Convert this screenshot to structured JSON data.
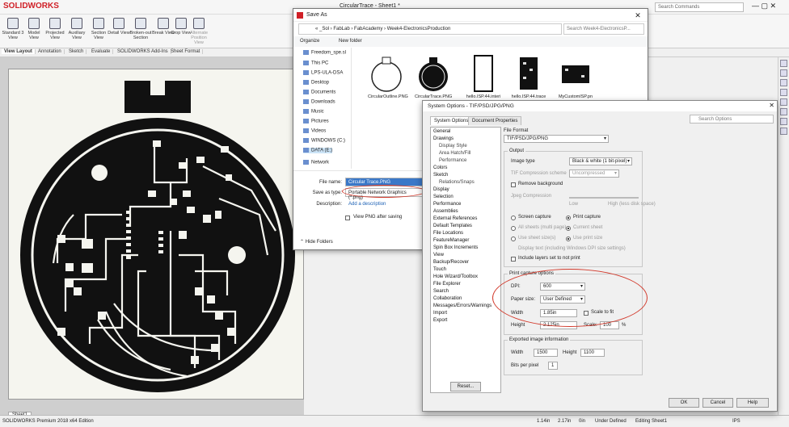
{
  "app": {
    "logo": "SOLIDWORKS",
    "title": "CircularTrace - Sheet1 *",
    "search_placeholder": "Search Commands"
  },
  "ribbon": [
    {
      "label": "Standard 3 View"
    },
    {
      "label": "Model View"
    },
    {
      "label": "Projected View"
    },
    {
      "label": "Auxiliary View"
    },
    {
      "label": "Section View"
    },
    {
      "label": "Detail View"
    },
    {
      "label": "Broken-out Section"
    },
    {
      "label": "Break View"
    },
    {
      "label": "Crop View"
    },
    {
      "label": "Alternate Position View"
    }
  ],
  "sheet_tabs": [
    "View Layout",
    "Annotation",
    "Sketch",
    "Evaluate",
    "SOLIDWORKS Add-Ins",
    "Sheet Format"
  ],
  "sheet_name": "Sheet1",
  "status": {
    "left": "SOLIDWORKS Premium 2018 x64 Edition",
    "x": "1.14in",
    "y": "2.17in",
    "z": "0in",
    "scale": "Under Defined",
    "mode": "Editing Sheet1",
    "units": "IPS"
  },
  "save_as": {
    "title": "Save As",
    "address": "« _Sol › FabLab › FabAcademy › Week4-ElectronicsProduction",
    "search": "Search Week4-ElectronicsP...",
    "organize": "Organize",
    "new_folder": "New folder",
    "nav": [
      "Freedom_spe.sl",
      "This PC",
      "LPS-ULA-DSA",
      "Desktop",
      "Documents",
      "Downloads",
      "Music",
      "Pictures",
      "Videos",
      "WINDOWS (C:)",
      "DATA (E:)",
      "Network"
    ],
    "files": [
      "CircularOutline.PNG",
      "CircularTrace.PNG",
      "hello.ISP.44.interi",
      "hello.ISP.44.trace",
      "MyCustomISP.pn"
    ],
    "file_name_label": "File name:",
    "file_name": "Circular Trace.PNG",
    "save_type_label": "Save as type:",
    "save_type": "Portable Network Graphics (*.png)",
    "description_label": "Description:",
    "description": "Add a description",
    "view_after": "View PNG after saving",
    "hide_folders": "Hide Folders"
  },
  "sysopt": {
    "title": "System Options - TIF/PSD/JPG/PNG",
    "tab_system": "System Options",
    "tab_document": "Document Properties",
    "search": "Search Options",
    "tree": [
      {
        "label": "General",
        "sub": false
      },
      {
        "label": "Drawings",
        "sub": false
      },
      {
        "label": "Display Style",
        "sub": true
      },
      {
        "label": "Area Hatch/Fill",
        "sub": true
      },
      {
        "label": "Performance",
        "sub": true
      },
      {
        "label": "Colors",
        "sub": false
      },
      {
        "label": "Sketch",
        "sub": false
      },
      {
        "label": "Relations/Snaps",
        "sub": true
      },
      {
        "label": "Display",
        "sub": false
      },
      {
        "label": "Selection",
        "sub": false
      },
      {
        "label": "Performance",
        "sub": false
      },
      {
        "label": "Assemblies",
        "sub": false
      },
      {
        "label": "External References",
        "sub": false
      },
      {
        "label": "Default Templates",
        "sub": false
      },
      {
        "label": "File Locations",
        "sub": false
      },
      {
        "label": "FeatureManager",
        "sub": false
      },
      {
        "label": "Spin Box Increments",
        "sub": false
      },
      {
        "label": "View",
        "sub": false
      },
      {
        "label": "Backup/Recover",
        "sub": false
      },
      {
        "label": "Touch",
        "sub": false
      },
      {
        "label": "Hole Wizard/Toolbox",
        "sub": false
      },
      {
        "label": "File Explorer",
        "sub": false
      },
      {
        "label": "Search",
        "sub": false
      },
      {
        "label": "Collaboration",
        "sub": false
      },
      {
        "label": "Messages/Errors/Warnings",
        "sub": false
      },
      {
        "label": "Import",
        "sub": false
      },
      {
        "label": "Export",
        "sub": false
      }
    ],
    "file_format_label": "File Format",
    "file_format": "TIF/PSD/JPG/PNG",
    "output_label": "Output",
    "image_type_label": "Image type",
    "image_type": "Black & white (1 bit-pixel)",
    "tif_comp_label": "TIF Compression scheme",
    "tif_comp": "Uncompressed",
    "remove_bg": "Remove background",
    "jpeg_comp": "Jpeg Compression",
    "jpeg_low": "Low",
    "jpeg_high": "High (less disk space)",
    "screen_capture": "Screen capture",
    "print_capture": "Print capture",
    "all_sheets": "All sheets (multi page)",
    "current_sheet": "Current sheet",
    "user_sizes": "Use sheet size(s)",
    "print_size": "Use print size",
    "print_note": "Display text (including Windows DPI size settings)",
    "include_layers": "Include layers set to not print",
    "print_capture_opts": "Print capture options",
    "dpi_label": "DPI:",
    "dpi": "600",
    "paper_label": "Paper size:",
    "paper": "User Defined",
    "width_label": "Width",
    "width": "1.85in",
    "height_label": "Height",
    "height": "2.125in",
    "scale_fit": "Scale to fit",
    "scale_label": "Scale:",
    "scale": "100",
    "pct": "%",
    "exported_label": "Exported image information",
    "exp_width_label": "Width",
    "exp_width": "1500",
    "exp_height_label": "Height",
    "exp_height": "1100",
    "bits_label": "Bits per pixel",
    "bits": "1",
    "reset": "Reset...",
    "ok": "OK",
    "cancel": "Cancel",
    "help": "Help"
  },
  "colors": {
    "annotation_red": "#d23a2c",
    "sw_red": "#d02027"
  }
}
